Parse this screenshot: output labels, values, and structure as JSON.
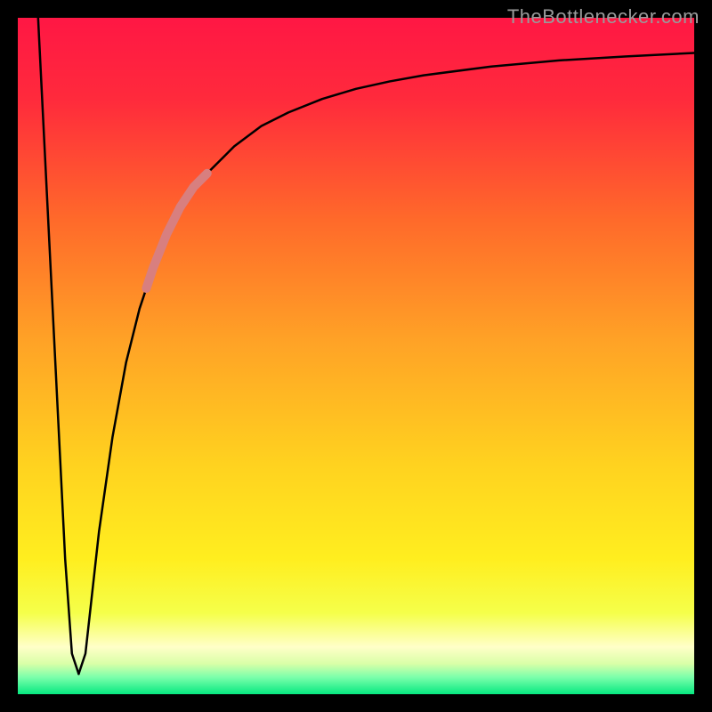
{
  "watermark": "TheBottlenecker.com",
  "chart_data": {
    "type": "line",
    "title": "",
    "xlabel": "",
    "ylabel": "",
    "xlim": [
      0,
      100
    ],
    "ylim": [
      0,
      100
    ],
    "background_gradient_stops": [
      {
        "offset": 0.0,
        "color": "#ff1744"
      },
      {
        "offset": 0.12,
        "color": "#ff2a3c"
      },
      {
        "offset": 0.3,
        "color": "#ff6a2a"
      },
      {
        "offset": 0.48,
        "color": "#ffa326"
      },
      {
        "offset": 0.66,
        "color": "#ffd21f"
      },
      {
        "offset": 0.8,
        "color": "#ffee1f"
      },
      {
        "offset": 0.88,
        "color": "#f5ff4a"
      },
      {
        "offset": 0.93,
        "color": "#ffffc8"
      },
      {
        "offset": 0.955,
        "color": "#d9ffa8"
      },
      {
        "offset": 0.975,
        "color": "#7bffab"
      },
      {
        "offset": 1.0,
        "color": "#06e880"
      }
    ],
    "series": [
      {
        "name": "left-branch",
        "x": [
          3,
          4,
          5,
          6,
          7,
          8,
          9
        ],
        "y": [
          100,
          80,
          60,
          40,
          20,
          6,
          3
        ],
        "stroke": "#000000",
        "stroke_width": 2.5
      },
      {
        "name": "right-branch",
        "x": [
          9,
          10,
          11,
          12,
          14,
          16,
          18,
          20,
          22,
          25,
          28,
          32,
          36,
          40,
          45,
          50,
          55,
          60,
          70,
          80,
          90,
          100
        ],
        "y": [
          3,
          6,
          15,
          24,
          38,
          49,
          57,
          63,
          68,
          73,
          77,
          81,
          84,
          86,
          88,
          89.5,
          90.6,
          91.5,
          92.8,
          93.7,
          94.3,
          94.8
        ],
        "stroke": "#000000",
        "stroke_width": 2.5
      },
      {
        "name": "highlight-segment",
        "x": [
          19,
          20,
          22,
          24,
          26,
          28
        ],
        "y": [
          60,
          63,
          68,
          72,
          75,
          77
        ],
        "stroke": "#d87f7f",
        "stroke_width": 10
      }
    ]
  }
}
